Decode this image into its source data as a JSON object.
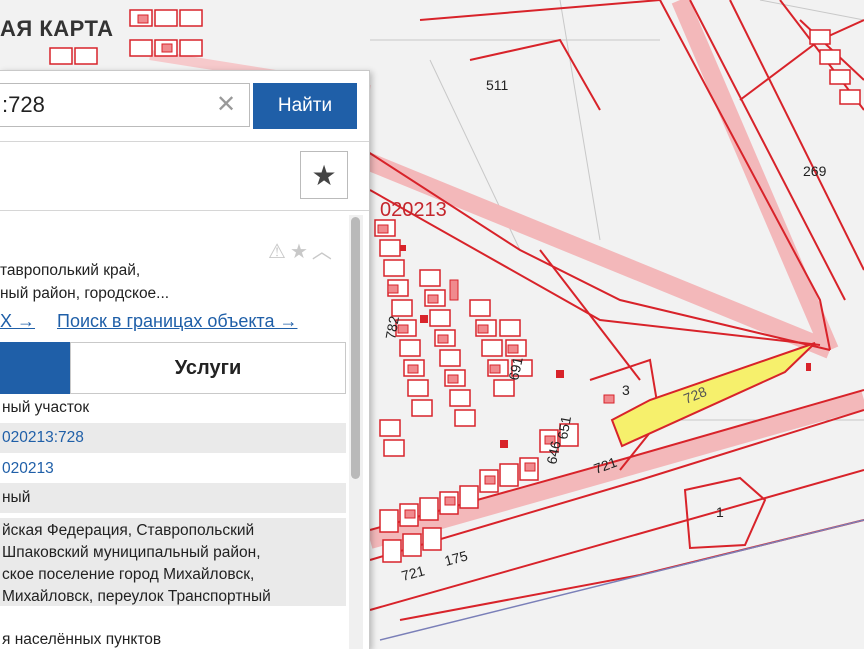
{
  "map": {
    "title": "АЯ КАРТА",
    "quarter_label": "020213",
    "parcel_labels": [
      "511",
      "269",
      "782",
      "691",
      "651",
      "646",
      "721",
      "721",
      "175",
      "3",
      "1",
      "728"
    ],
    "colors": {
      "parcel_stroke": "#d8232a",
      "selected_fill": "#f6f06c",
      "building_fill": "#f08a8e"
    }
  },
  "search": {
    "value": ":728",
    "clear_icon": "close-icon",
    "button_label": "Найти"
  },
  "favorite": {
    "icon": "star-icon"
  },
  "card": {
    "address_lines": [
      "таврополький край,",
      "ный район, городское..."
    ],
    "link_left": "Х →",
    "link_right": "Поиск в границах объекта →",
    "tab_services": "Услуги"
  },
  "details": {
    "type": "ный участок",
    "cadastral_number": "020213:728",
    "quarter": "020213",
    "status": "ный",
    "address_full": [
      "йская Федерация, Ставропольский",
      "Шпаковский муниципальный район,",
      "ское поселение город Михайловск,",
      "Михайловск, переулок Транспортный"
    ],
    "category": "я населённых пунктов"
  }
}
